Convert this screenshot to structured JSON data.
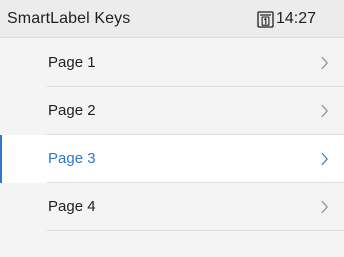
{
  "header": {
    "title": "SmartLabel Keys",
    "time": "14:27",
    "line_icon": "line-1-icon"
  },
  "menu": {
    "items": [
      {
        "label": "Page 1",
        "selected": false,
        "icon": "chevron-right-icon"
      },
      {
        "label": "Page 2",
        "selected": false,
        "icon": "chevron-right-icon"
      },
      {
        "label": "Page 3",
        "selected": true,
        "icon": "chevron-right-icon"
      },
      {
        "label": "Page 4",
        "selected": false,
        "icon": "chevron-right-icon"
      }
    ]
  },
  "colors": {
    "accent": "#2f78c9",
    "background": "#f4f4f4",
    "selected_background": "#ffffff",
    "text": "#1f1f1f",
    "chevron": "#8a8a8a"
  }
}
